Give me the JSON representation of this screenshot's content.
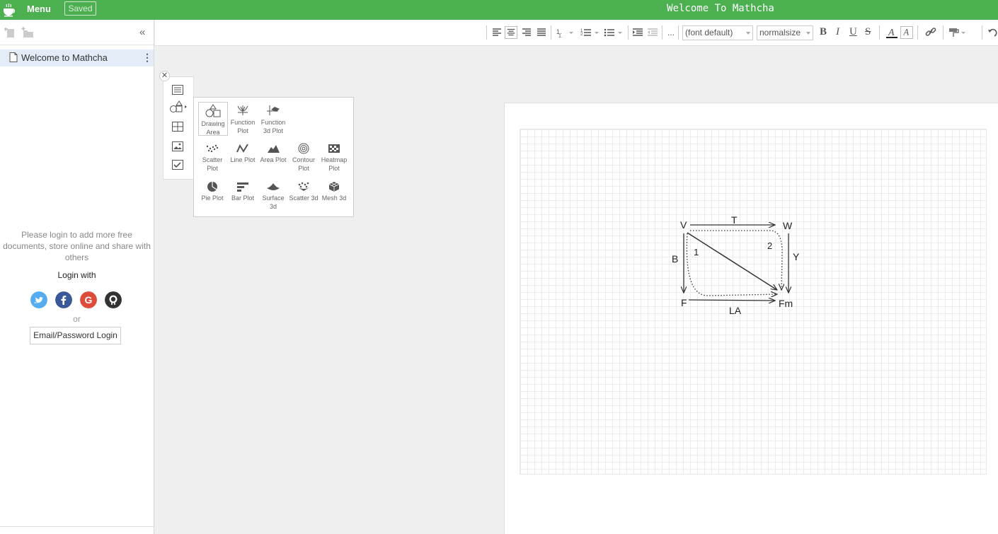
{
  "app": {
    "menu_label": "Menu",
    "saved_label": "Saved",
    "document_title": "Welcome To Mathcha",
    "accent_color": "#4caf50"
  },
  "sidebar": {
    "document_name": "Welcome to Mathcha",
    "login_prompt": "Please login to add more free documents, store online and share with others",
    "login_with": "Login with",
    "social_providers": [
      {
        "name": "twitter",
        "color": "#55acee"
      },
      {
        "name": "facebook",
        "color": "#3b5998"
      },
      {
        "name": "google",
        "color": "#dd4b39"
      },
      {
        "name": "github",
        "color": "#333333"
      }
    ],
    "or_label": "or",
    "email_login_label": "Email/Password Login"
  },
  "toolbar": {
    "font_select": "(font default)",
    "size_select": "normalsize",
    "bold": "B",
    "italic": "I",
    "underline": "U",
    "strike": "S",
    "more": "..."
  },
  "insert_panel": {
    "items": [
      {
        "label": "Drawing Area",
        "icon": "drawing-area-icon"
      },
      {
        "label": "Function Plot",
        "icon": "function-plot-icon"
      },
      {
        "label": "Function 3d Plot",
        "icon": "function-3d-plot-icon"
      },
      {
        "label": "Scatter Plot",
        "icon": "scatter-plot-icon"
      },
      {
        "label": "Line Plot",
        "icon": "line-plot-icon"
      },
      {
        "label": "Area Plot",
        "icon": "area-plot-icon"
      },
      {
        "label": "Contour Plot",
        "icon": "contour-plot-icon"
      },
      {
        "label": "Heatmap Plot",
        "icon": "heatmap-plot-icon"
      },
      {
        "label": "Pie Plot",
        "icon": "pie-plot-icon"
      },
      {
        "label": "Bar Plot",
        "icon": "bar-plot-icon"
      },
      {
        "label": "Surface 3d",
        "icon": "surface-3d-icon"
      },
      {
        "label": "Scatter 3d",
        "icon": "scatter-3d-icon"
      },
      {
        "label": "Mesh 3d",
        "icon": "mesh-3d-icon"
      }
    ]
  },
  "diagram": {
    "nodes": {
      "V": "V",
      "W": "W",
      "F": "F",
      "Fm": "Fm"
    },
    "arrows": {
      "top": "T",
      "left": "B",
      "right": "Y",
      "bottom": "LA"
    },
    "regions": {
      "one": "1",
      "two": "2"
    }
  }
}
